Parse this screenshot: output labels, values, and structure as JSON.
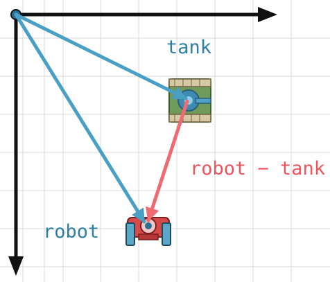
{
  "labels": {
    "tank": "tank",
    "robot": "robot",
    "difference": "robot − tank"
  },
  "colors": {
    "grid": "#d9d9d9",
    "axis": "#111111",
    "position_vector": "#4a9fc4",
    "difference_vector": "#f06a72",
    "label_blue": "#2e7ea6",
    "label_red": "#f0555e",
    "tank_body": "#6f9a5a",
    "tank_tread": "#d7c9a3",
    "robot_body": "#d84a4a"
  },
  "icons": {
    "tank": "tank-sprite-icon",
    "robot": "robot-sprite-icon",
    "origin": "origin-dot-icon"
  }
}
